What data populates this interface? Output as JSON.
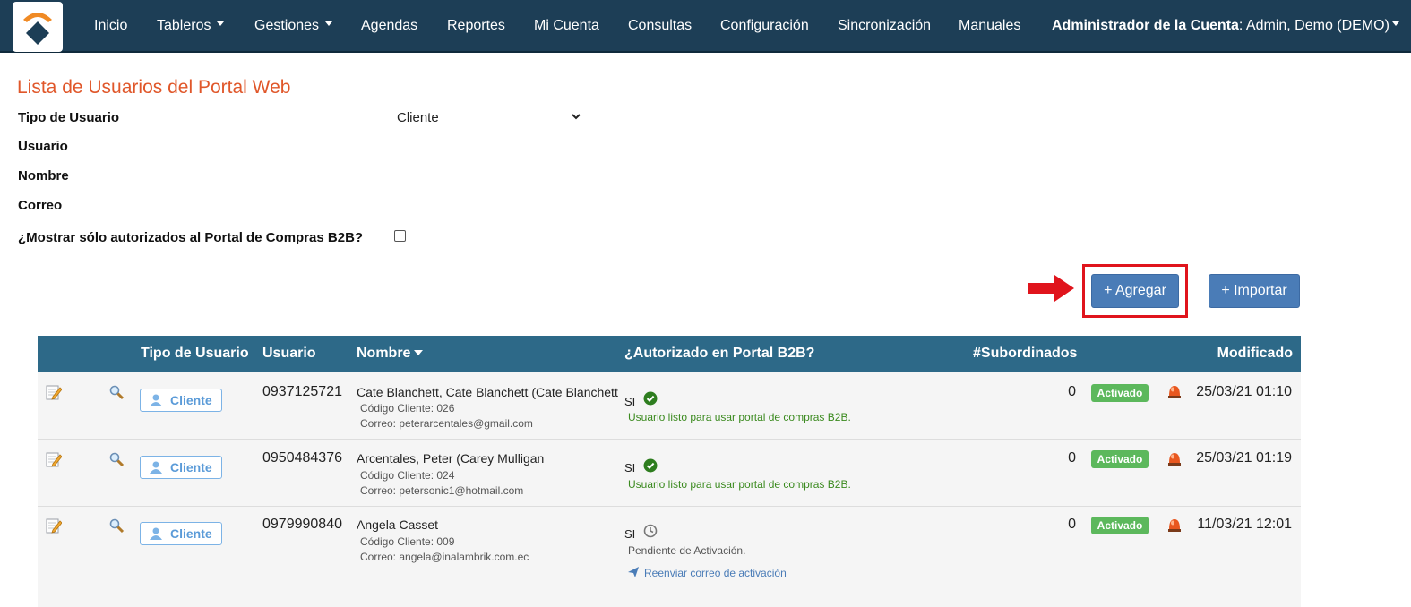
{
  "navbar": {
    "items": [
      {
        "label": "Inicio",
        "dropdown": false
      },
      {
        "label": "Tableros",
        "dropdown": true
      },
      {
        "label": "Gestiones",
        "dropdown": true
      },
      {
        "label": "Agendas",
        "dropdown": false
      },
      {
        "label": "Reportes",
        "dropdown": false
      },
      {
        "label": "Mi Cuenta",
        "dropdown": false
      },
      {
        "label": "Consultas",
        "dropdown": false
      },
      {
        "label": "Configuración",
        "dropdown": false
      },
      {
        "label": "Sincronización",
        "dropdown": false
      },
      {
        "label": "Manuales",
        "dropdown": false
      }
    ],
    "account_role": "Administrador de la Cuenta",
    "account_name": ": Admin, Demo (DEMO)"
  },
  "page": {
    "title": "Lista de Usuarios del Portal Web"
  },
  "filters": {
    "tipo_label": "Tipo de Usuario",
    "tipo_value": "Cliente",
    "usuario_label": "Usuario",
    "nombre_label": "Nombre",
    "correo_label": "Correo",
    "b2b_label": "¿Mostrar sólo autorizados al Portal de Compras B2B?",
    "b2b_checked": false
  },
  "actions": {
    "add_label": "+ Agregar",
    "import_label": "+ Importar"
  },
  "table": {
    "headers": {
      "tipo": "Tipo de Usuario",
      "usuario": "Usuario",
      "nombre": "Nombre",
      "autorizado": "¿Autorizado en Portal B2B?",
      "subordinados": "#Subordinados",
      "modificado": "Modificado"
    },
    "rows": [
      {
        "type": "Cliente",
        "usuario": "0937125721",
        "nombre": "Cate Blanchett, Cate Blanchett (Cate Blanchett",
        "codigo": "Código Cliente: 026",
        "correo": "Correo: peterarcentales@gmail.com",
        "auth_si": "SI",
        "auth_state": "ok",
        "auth_msg": "Usuario listo para usar portal de compras B2B.",
        "subordinados": "0",
        "estado": "Activado",
        "modificado": "25/03/21 01:10"
      },
      {
        "type": "Cliente",
        "usuario": "0950484376",
        "nombre": "Arcentales, Peter (Carey Mulligan",
        "codigo": "Código Cliente: 024",
        "correo": "Correo: petersonic1@hotmail.com",
        "auth_si": "SI",
        "auth_state": "ok",
        "auth_msg": "Usuario listo para usar portal de compras B2B.",
        "subordinados": "0",
        "estado": "Activado",
        "modificado": "25/03/21 01:19"
      },
      {
        "type": "Cliente",
        "usuario": "0979990840",
        "nombre": "Angela Casset",
        "codigo": "Código Cliente: 009",
        "correo": "Correo: angela@inalambrik.com.ec",
        "auth_si": "SI",
        "auth_state": "pending",
        "auth_msg": "Pendiente de Activación.",
        "resend": "Reenviar correo de activación",
        "subordinados": "0",
        "estado": "Activado",
        "modificado": "11/03/21 12:01"
      }
    ]
  },
  "colors": {
    "navbar_bg": "#1d3e56",
    "title": "#e0572a",
    "table_header": "#2d6988",
    "primary_button": "#4a7cb7",
    "status_green": "#5cb85c",
    "highlight_red": "#e0141c"
  },
  "icons": {
    "logo": "company-logo",
    "edit": "edit-icon",
    "view": "magnifier-icon",
    "user": "user-icon",
    "check": "check-circle-icon",
    "clock": "clock-icon",
    "send": "paper-plane-icon",
    "alarm": "alarm-light-icon",
    "arrow": "right-arrow-icon"
  }
}
